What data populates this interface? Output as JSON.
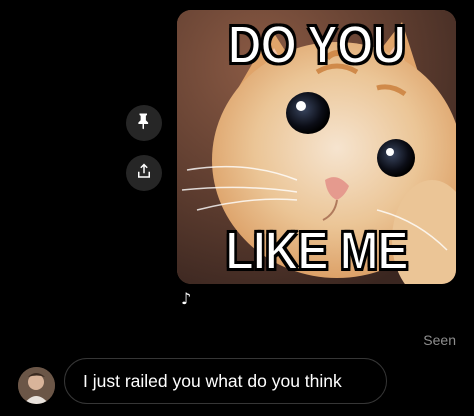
{
  "actions": {
    "pin_icon": "pin-icon",
    "share_icon": "share-icon"
  },
  "meme": {
    "top_text": "DO YOU",
    "bottom_text": "LIKE ME"
  },
  "attachment_marker": "♪",
  "status": {
    "seen_label": "Seen"
  },
  "reply": {
    "message_text": "I just railed you what do you think"
  },
  "colors": {
    "background": "#000000",
    "button_bg": "#262626",
    "bubble_border": "#363636",
    "muted_text": "#8e8e8e"
  }
}
